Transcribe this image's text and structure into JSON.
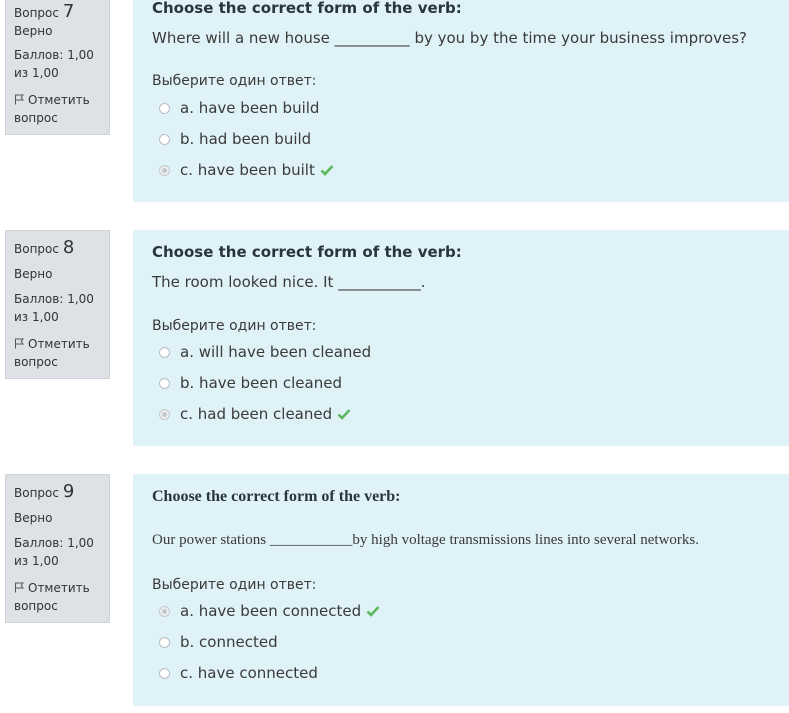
{
  "questions": [
    {
      "label": "Вопрос",
      "number": "7",
      "state": "Верно",
      "grade": "Баллов: 1,00 из 1,00",
      "flag_label": "Отметить вопрос",
      "title": "Choose the correct form of the verb:",
      "text": "Where will a new house __________ by you by the time your business improves?",
      "prompt": "Выберите один ответ:",
      "options": [
        {
          "label": "a. have been build",
          "checked": false,
          "correct": false
        },
        {
          "label": "b. had been build",
          "checked": false,
          "correct": false
        },
        {
          "label": "c. have been built",
          "checked": true,
          "correct": true
        }
      ]
    },
    {
      "label": "Вопрос",
      "number": "8",
      "state": "Верно",
      "grade": "Баллов: 1,00 из 1,00",
      "flag_label": "Отметить вопрос",
      "title": "Choose the correct form of the verb:",
      "text": "The room looked nice. It ___________.",
      "prompt": "Выберите один ответ:",
      "options": [
        {
          "label": "a. will have been cleaned",
          "checked": false,
          "correct": false
        },
        {
          "label": "b. have been cleaned",
          "checked": false,
          "correct": false
        },
        {
          "label": "c. had been cleaned",
          "checked": true,
          "correct": true
        }
      ]
    },
    {
      "label": "Вопрос",
      "number": "9",
      "state": "Верно",
      "grade": "Баллов: 1,00 из 1,00",
      "flag_label": "Отметить вопрос",
      "title": "Choose the correct form of the verb:",
      "text": "Our power stations ___________by high voltage transmissions lines into several networks.",
      "prompt": "Выберите один ответ:",
      "options": [
        {
          "label": "a. have been connected",
          "checked": true,
          "correct": true
        },
        {
          "label": "b. connected",
          "checked": false,
          "correct": false
        },
        {
          "label": "c. have connected",
          "checked": false,
          "correct": false
        }
      ]
    }
  ],
  "colors": {
    "content_bg": "#def2f8",
    "info_bg": "#dee2e6",
    "check": "#5cb85c"
  },
  "icons": {
    "flag": "flag-icon",
    "correct": "check-icon",
    "radio": "radio-icon"
  }
}
